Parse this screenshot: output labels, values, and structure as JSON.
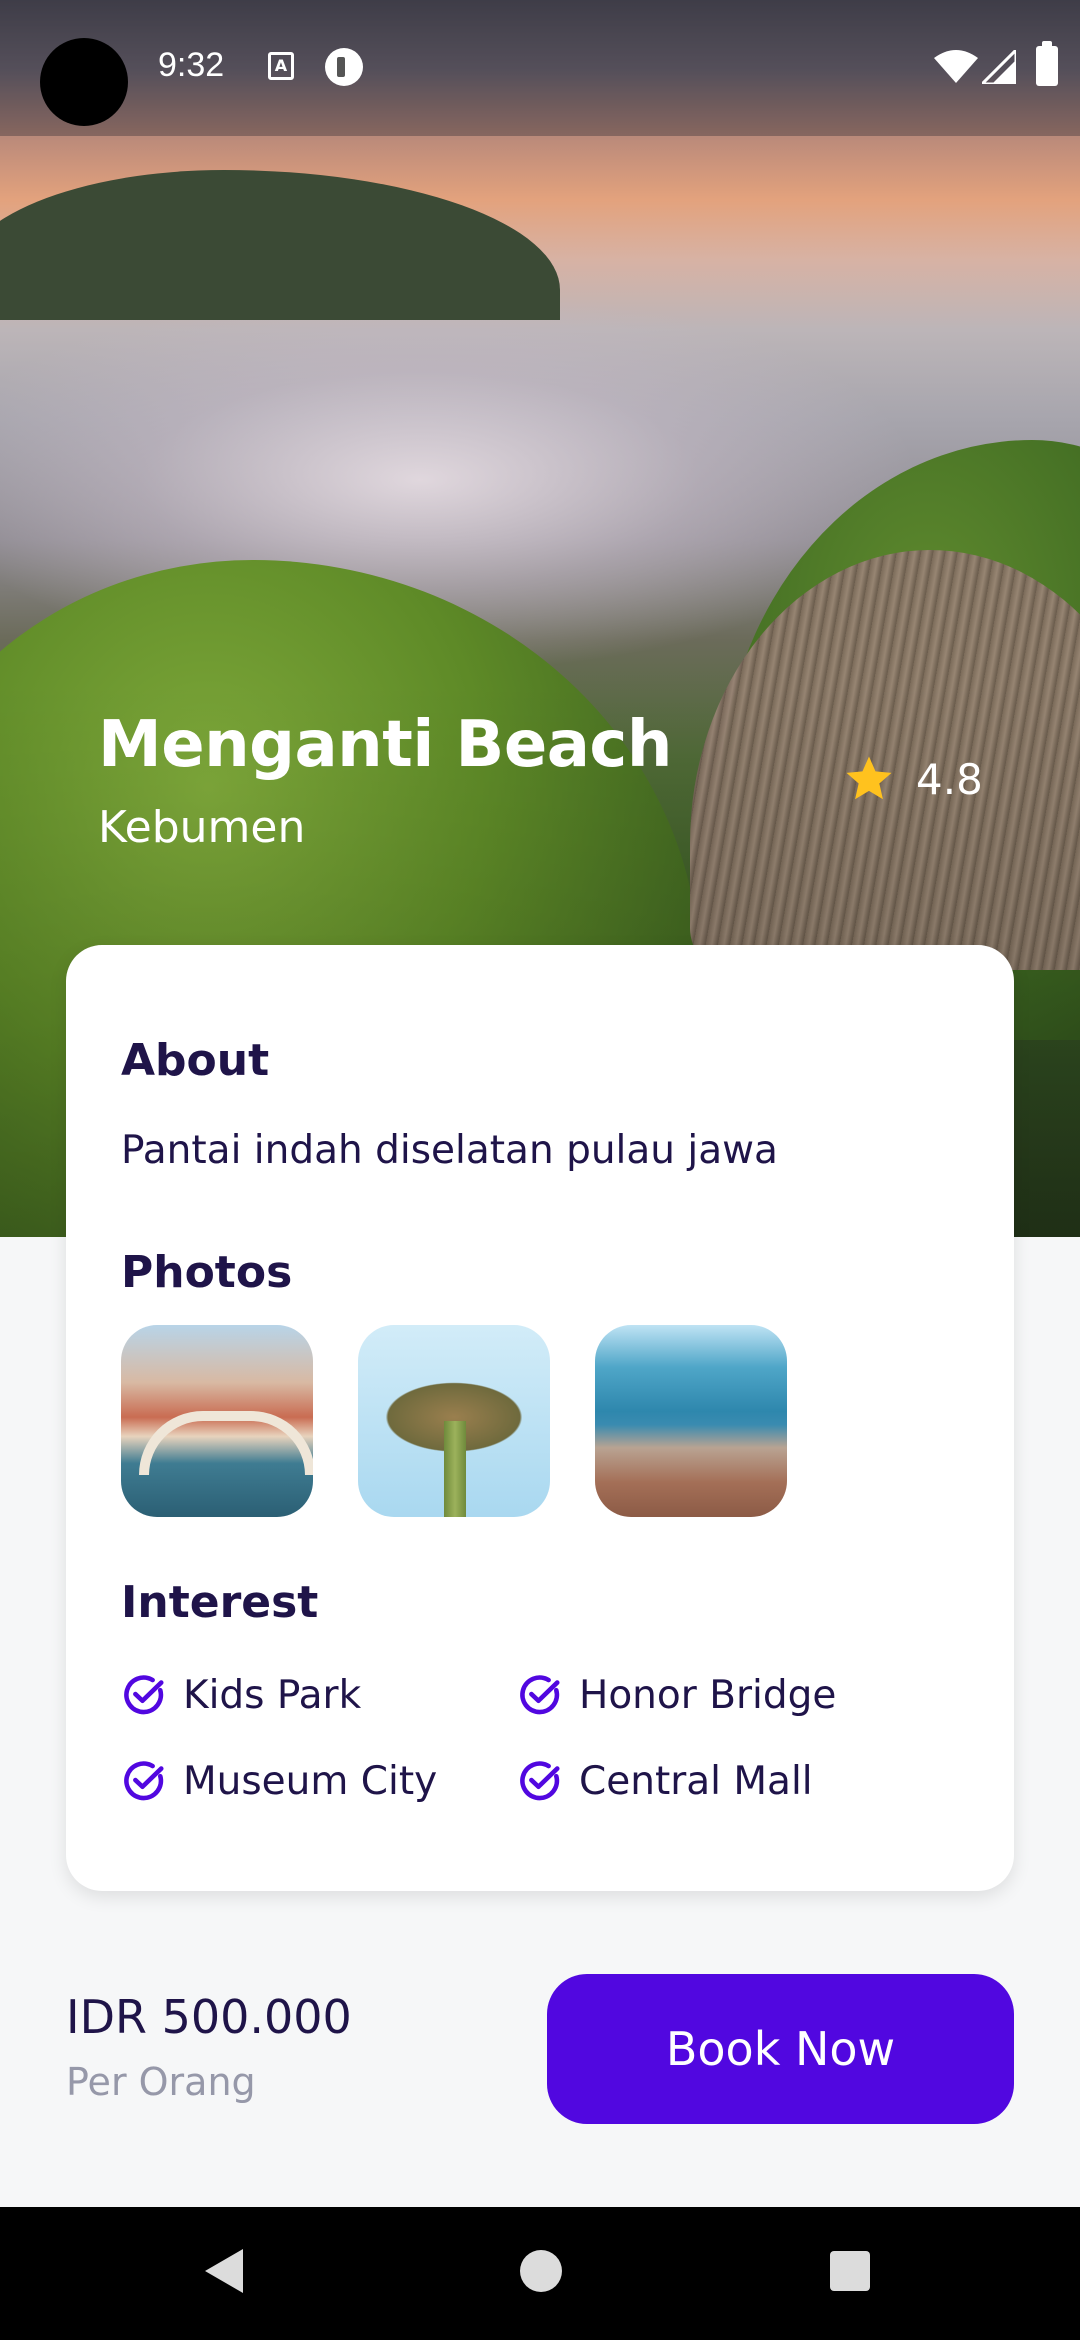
{
  "status_bar": {
    "time": "9:32",
    "notification_icons": [
      "accessibility-a-icon",
      "pocket-app-icon"
    ],
    "system_icons": [
      "wifi-icon",
      "signal-icon",
      "battery-icon"
    ]
  },
  "hero": {
    "title": "Menganti Beach",
    "location": "Kebumen",
    "rating": "4.8",
    "star_color": "#FFC21E"
  },
  "about": {
    "heading": "About",
    "text": "Pantai indah diselatan pulau jawa"
  },
  "photos": {
    "heading": "Photos",
    "items": [
      "photo-venice-bridge",
      "photo-supertree",
      "photo-coastal-city"
    ]
  },
  "interest": {
    "heading": "Interest",
    "items": [
      {
        "label": "Kids Park"
      },
      {
        "label": "Honor Bridge"
      },
      {
        "label": "Museum City"
      },
      {
        "label": "Central Mall"
      }
    ],
    "icon_color": "#5107E0"
  },
  "footer": {
    "price": "IDR 500.000",
    "unit": "Per Orang",
    "book_label": "Book Now",
    "accent": "#5107E0"
  },
  "nav_bar": {
    "icons": [
      "back-icon",
      "home-icon",
      "recents-icon"
    ]
  }
}
